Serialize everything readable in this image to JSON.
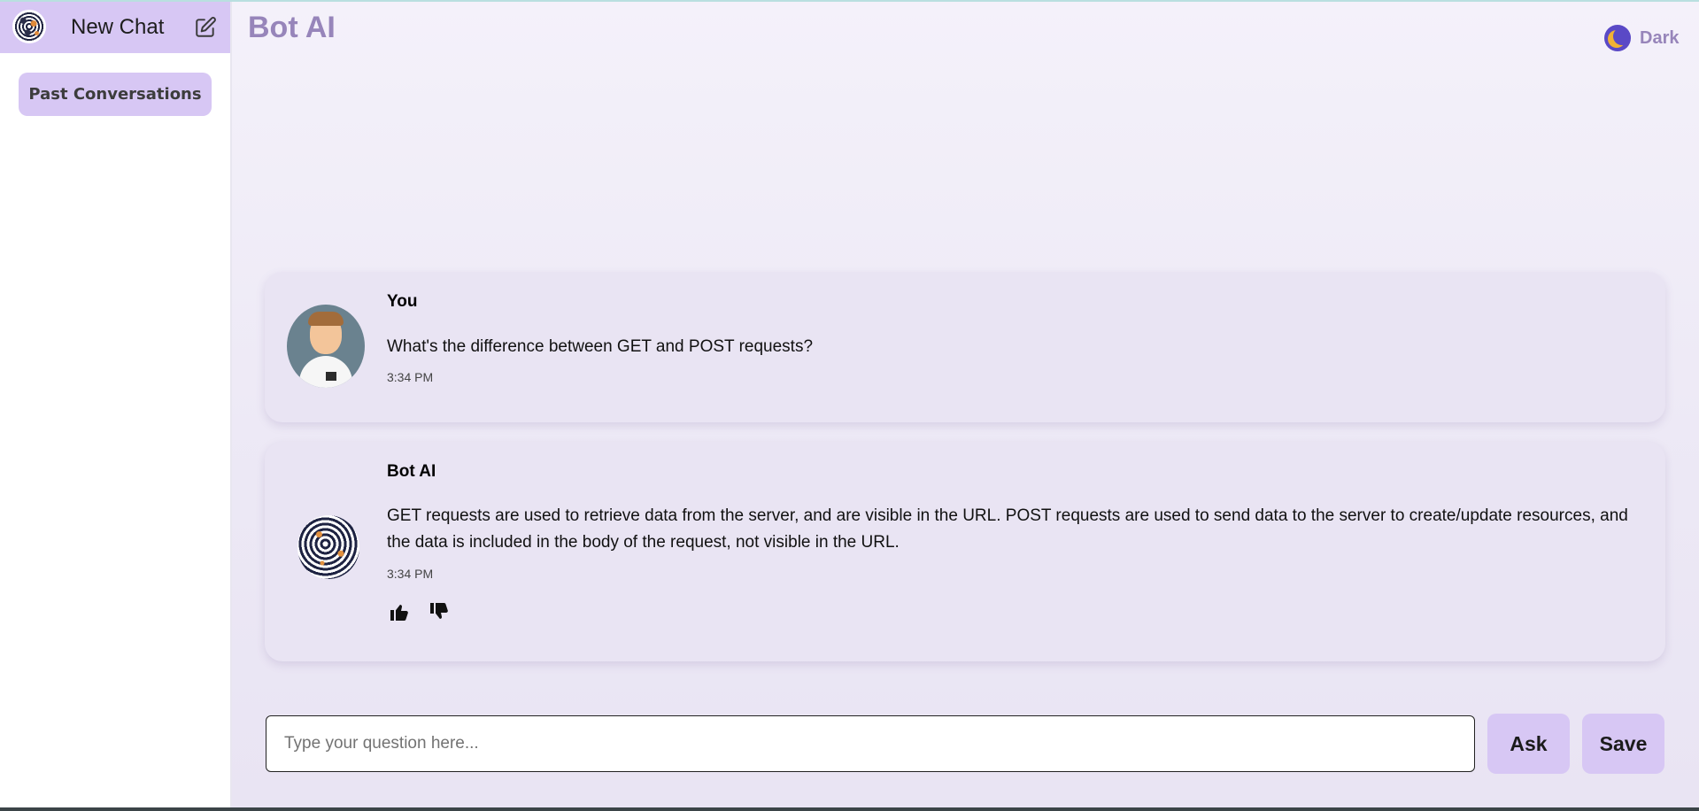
{
  "sidebar": {
    "new_chat_label": "New Chat",
    "past_conversations_label": "Past Conversations",
    "logo_icon": "bot-logo-icon",
    "edit_icon": "edit-icon"
  },
  "header": {
    "title": "Bot AI",
    "theme_label": "Dark",
    "theme_icon": "moon-icon"
  },
  "messages": [
    {
      "sender": "You",
      "text": "What's the difference between GET and POST requests?",
      "time": "3:34 PM"
    },
    {
      "sender": "Bot AI",
      "text": "GET requests are used to retrieve data from the server, and are visible in the URL. POST requests are used to send data to the server to create/update resources, and the data is included in the body of the request, not visible in the URL.",
      "time": "3:34 PM",
      "feedback_icons": [
        "thumbs-up-icon",
        "thumbs-down-icon"
      ]
    }
  ],
  "composer": {
    "placeholder": "Type your question here...",
    "value": "",
    "ask_label": "Ask",
    "save_label": "Save"
  },
  "colors": {
    "accent": "#d7c7f4",
    "title": "#9785ba",
    "card": "#e9e4f3"
  }
}
